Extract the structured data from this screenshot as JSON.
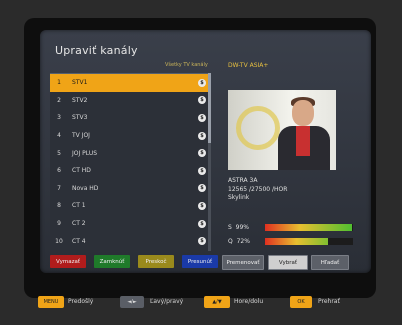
{
  "title": "Upraviť kanály",
  "list_header": "Všetky TV kanály",
  "satellite_header": "DW-TV ASIA+",
  "channels": [
    {
      "num": "1",
      "name": "STV1"
    },
    {
      "num": "2",
      "name": "STV2"
    },
    {
      "num": "3",
      "name": "STV3"
    },
    {
      "num": "4",
      "name": "TV JOJ"
    },
    {
      "num": "5",
      "name": "JOJ PLUS"
    },
    {
      "num": "6",
      "name": "CT HD"
    },
    {
      "num": "7",
      "name": "Nova HD"
    },
    {
      "num": "8",
      "name": "CT 1"
    },
    {
      "num": "9",
      "name": "CT 2"
    },
    {
      "num": "10",
      "name": "CT 4"
    }
  ],
  "channel_badge": "$",
  "selected_index": 0,
  "info": {
    "satellite": "ASTRA 3A",
    "transponder": "12565 /27500 /HOR",
    "provider": "Skylink"
  },
  "signal": {
    "s_label": "S",
    "s_value": "99%",
    "s_level": 0.99,
    "q_label": "Q",
    "q_value": "72%",
    "q_level": 0.72
  },
  "buttons": {
    "delete": "Vymazať",
    "lock": "Zamknúť",
    "skip": "Preskoč",
    "move": "Presunúť",
    "rename": "Premenovať",
    "select": "Vybrať",
    "find": "Hľadať"
  },
  "footer": {
    "menu_key": "MENU",
    "menu_label": "Predošlý",
    "lr_key": "◄/►",
    "lr_label": "Ľavý/pravý",
    "ud_key": "▲/▼",
    "ud_label": "Hore/dolu",
    "ok_key": "OK",
    "ok_label": "Prehrať"
  },
  "colors": {
    "highlight": "#f0a417",
    "red_button": "#b01c1c",
    "green_button": "#1f7a2a",
    "yellow_button": "#9a8a1c",
    "blue_button": "#1a3aa8"
  }
}
